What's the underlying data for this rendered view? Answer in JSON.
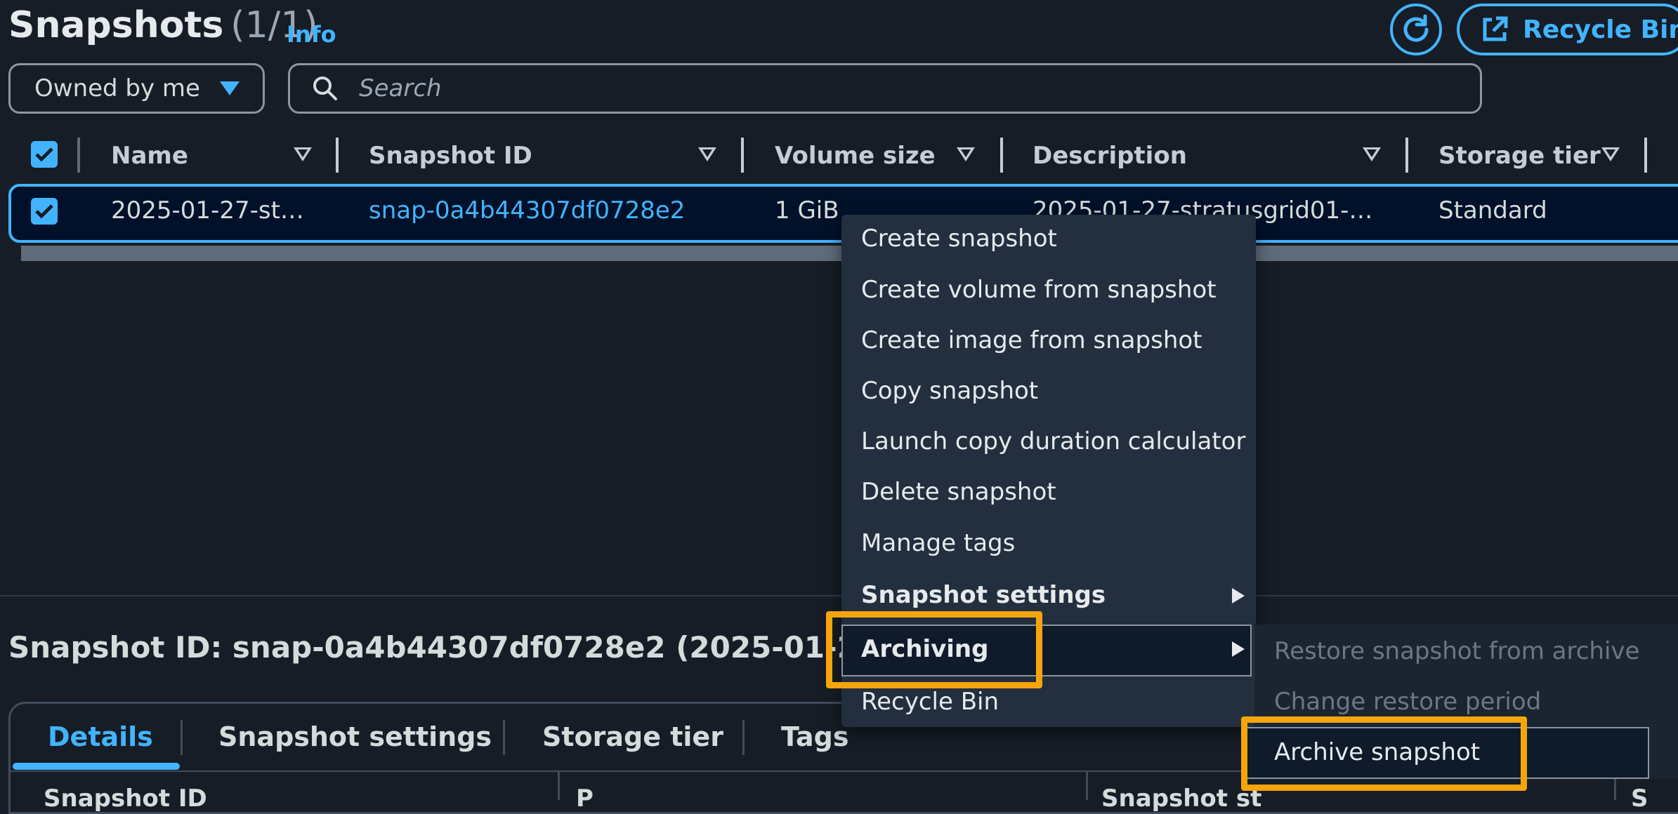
{
  "header": {
    "title": "Snapshots",
    "count": "(1/1)",
    "info_label": "Info",
    "refresh_icon": "refresh-icon",
    "recycle_bin_label": "Recycle Bin",
    "recycle_bin_icon": "external-link-icon"
  },
  "filters": {
    "owner_select_value": "Owned by me",
    "search_placeholder": "Search"
  },
  "table": {
    "columns": [
      "Name",
      "Snapshot ID",
      "Volume size",
      "Description",
      "Storage tier"
    ],
    "rows": [
      {
        "name": "2025-01-27-st…",
        "snapshot_id": "snap-0a4b44307df0728e2",
        "volume_size": "1 GiB",
        "description": "2025-01-27-stratusgrid01-…",
        "storage_tier": "Standard",
        "selected": true
      }
    ]
  },
  "context_menu": {
    "items": [
      {
        "label": "Create snapshot"
      },
      {
        "label": "Create volume from snapshot"
      },
      {
        "label": "Create image from snapshot"
      },
      {
        "label": "Copy snapshot"
      },
      {
        "label": "Launch copy duration calculator"
      },
      {
        "label": "Delete snapshot"
      },
      {
        "label": "Manage tags"
      },
      {
        "label": "Snapshot settings",
        "submenu": true
      },
      {
        "label": "Archiving",
        "submenu": true,
        "expanded": true
      },
      {
        "label": "Recycle Bin"
      }
    ],
    "archiving_submenu": [
      {
        "label": "Restore snapshot from archive",
        "disabled": true
      },
      {
        "label": "Change restore period",
        "disabled": true
      },
      {
        "label": "Archive snapshot",
        "disabled": false
      }
    ]
  },
  "details": {
    "title": "Snapshot ID: snap-0a4b44307df0728e2 (2025-01-27-",
    "tabs": [
      "Details",
      "Snapshot settings",
      "Storage tier",
      "Tags"
    ],
    "active_tab": "Details",
    "field_headers": [
      "Snapshot ID",
      "P",
      "Snapshot st",
      "S"
    ]
  },
  "colors": {
    "background": "#161d26",
    "accent": "#42b4ff",
    "selected_row": "#001129",
    "menu_bg": "#232f3e",
    "highlight": "#f5a50b"
  }
}
